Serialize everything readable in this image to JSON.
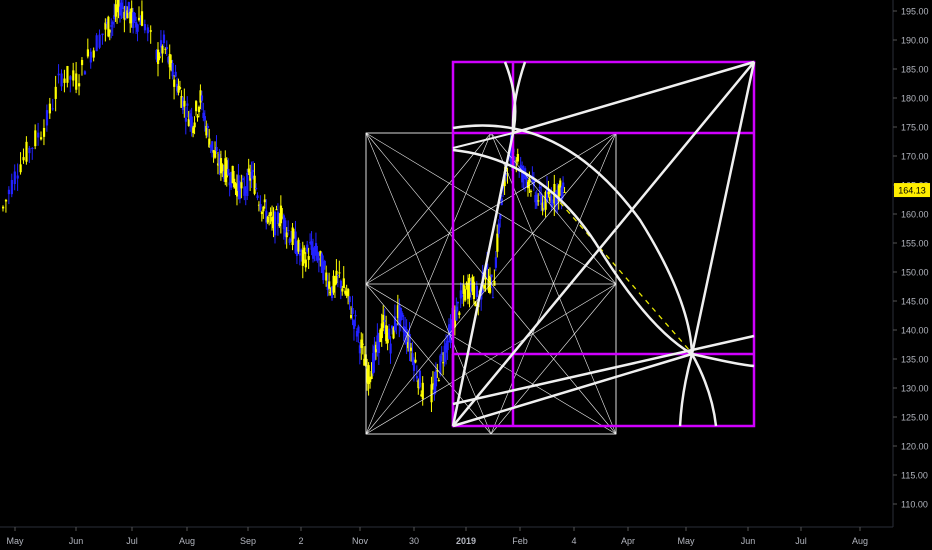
{
  "chart_data": {
    "type": "candlestick",
    "title": "",
    "colors": {
      "background": "#000000",
      "candle_up": "#ffff00",
      "candle_down": "#2222ff",
      "axis_text": "#b2b5be",
      "price_badge": "#ffee00",
      "fib_box": "#d000ff",
      "fib_lines": "#f0f0f0",
      "projection": "#e8e800"
    },
    "y_axis": {
      "ticks": [
        "195.00",
        "190.00",
        "185.00",
        "180.00",
        "175.00",
        "170.00",
        "165.00",
        "160.00",
        "155.00",
        "150.00",
        "145.00",
        "140.00",
        "135.00",
        "130.00",
        "125.00",
        "120.00",
        "115.00",
        "110.00"
      ],
      "range": [
        105,
        197
      ]
    },
    "x_axis": {
      "ticks": [
        "May",
        "Jun",
        "Jul",
        "Aug",
        "Sep",
        "2",
        "Nov",
        "30",
        "2019",
        "Feb",
        "4",
        "Apr",
        "May",
        "Jun",
        "Jul",
        "Aug"
      ]
    },
    "last_price": "164.13",
    "price_path": [
      [
        0,
        161
      ],
      [
        2,
        168
      ],
      [
        4,
        172
      ],
      [
        6,
        176
      ],
      [
        8,
        184
      ],
      [
        10,
        183
      ],
      [
        12,
        188
      ],
      [
        14,
        192
      ],
      [
        15,
        193
      ],
      [
        16,
        196
      ],
      [
        17,
        195
      ],
      [
        18,
        193
      ],
      [
        19,
        194
      ],
      [
        21,
        187
      ],
      [
        22,
        189
      ],
      [
        23,
        185
      ],
      [
        24,
        182
      ],
      [
        25,
        178
      ],
      [
        26,
        176
      ],
      [
        27,
        180
      ],
      [
        28,
        174
      ],
      [
        29,
        170
      ],
      [
        30,
        168
      ],
      [
        31,
        167
      ],
      [
        32,
        165
      ],
      [
        33,
        164
      ],
      [
        34,
        167
      ],
      [
        35,
        163
      ],
      [
        36,
        160
      ],
      [
        37,
        158
      ],
      [
        38,
        160
      ],
      [
        39,
        157
      ],
      [
        40,
        155
      ],
      [
        41,
        152
      ],
      [
        42,
        154
      ],
      [
        43,
        153
      ],
      [
        44,
        150
      ],
      [
        45,
        147
      ],
      [
        46,
        149
      ],
      [
        47,
        146
      ],
      [
        48,
        142
      ],
      [
        49,
        137
      ],
      [
        50,
        132
      ],
      [
        51,
        136
      ],
      [
        52,
        141
      ],
      [
        53,
        138
      ],
      [
        54,
        143
      ],
      [
        55,
        140
      ],
      [
        56,
        136
      ],
      [
        57,
        131
      ],
      [
        58,
        127
      ],
      [
        59,
        130
      ],
      [
        60,
        135
      ],
      [
        61,
        139
      ],
      [
        62,
        143
      ],
      [
        63,
        146
      ],
      [
        64,
        148
      ],
      [
        65,
        145
      ],
      [
        66,
        150
      ],
      [
        67,
        147
      ],
      [
        68,
        160
      ],
      [
        69,
        169
      ],
      [
        70,
        171
      ],
      [
        71,
        167
      ],
      [
        72,
        166
      ],
      [
        73,
        163
      ],
      [
        74,
        162
      ],
      [
        75,
        163
      ],
      [
        76,
        164
      ],
      [
        77,
        164
      ]
    ],
    "annotations": {
      "projection_end_price": 136
    }
  }
}
